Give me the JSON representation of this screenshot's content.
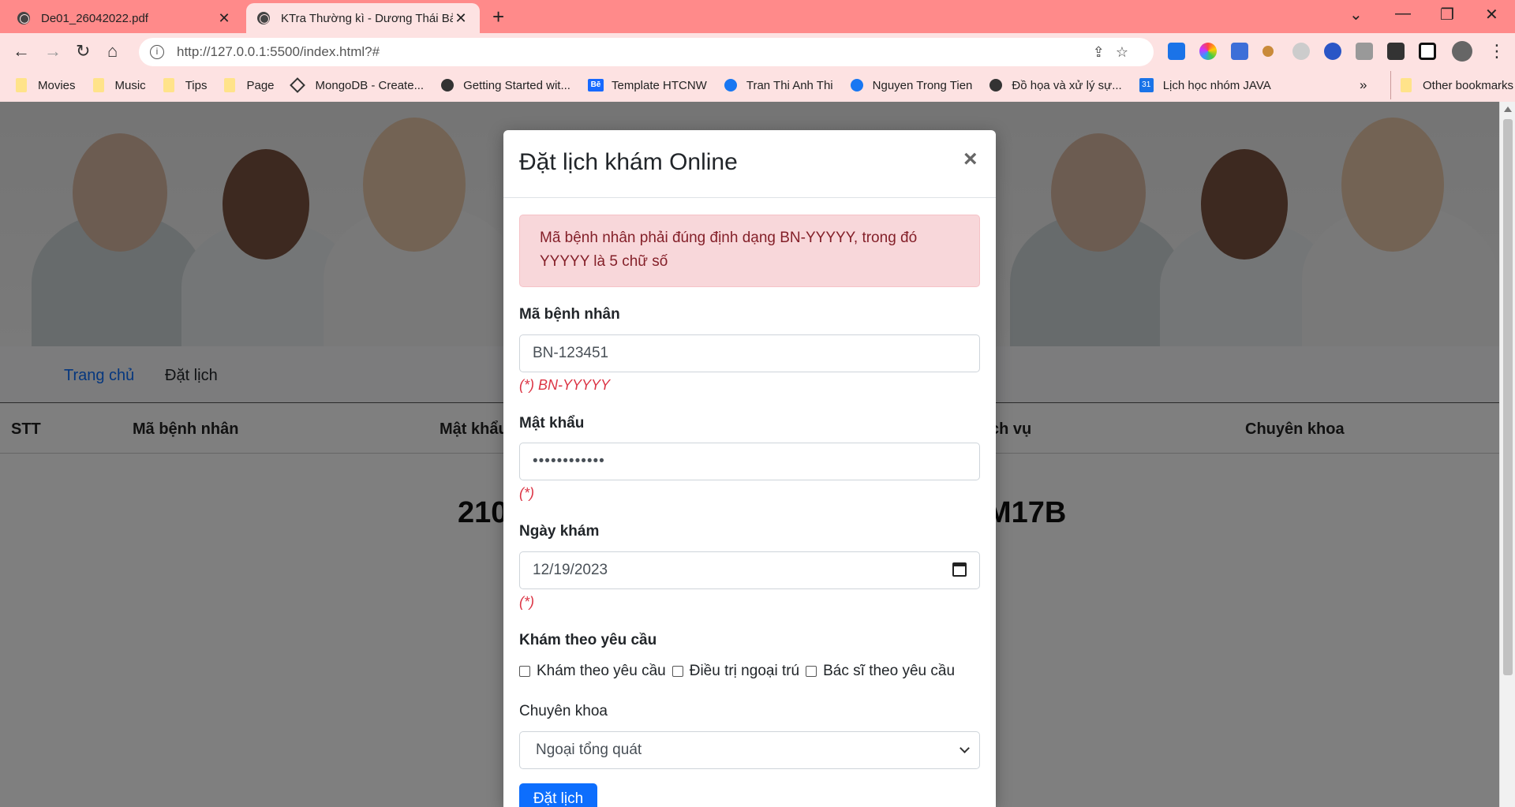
{
  "browser": {
    "tabs": [
      {
        "title": "De01_26042022.pdf",
        "active": false
      },
      {
        "title": "KTra Thường kì - Dương Thái Bảo",
        "active": true
      }
    ],
    "url": "http://127.0.0.1:5500/index.html?#",
    "bookmarks": [
      {
        "label": "Movies",
        "icon": "folder-icon"
      },
      {
        "label": "Music",
        "icon": "folder-icon"
      },
      {
        "label": "Tips",
        "icon": "folder-icon"
      },
      {
        "label": "Page",
        "icon": "folder-icon"
      },
      {
        "label": "MongoDB - Create...",
        "icon": "mongodb-icon"
      },
      {
        "label": "Getting Started wit...",
        "icon": "globe-icon"
      },
      {
        "label": "Template HTCNW",
        "icon": "behance-icon"
      },
      {
        "label": "Tran Thi Anh Thi",
        "icon": "facebook-icon"
      },
      {
        "label": "Nguyen Trong Tien",
        "icon": "facebook-icon"
      },
      {
        "label": "Đồ họa và xử lý sự...",
        "icon": "globe-icon"
      },
      {
        "label": "Lịch học nhóm JAVA",
        "icon": "calendar-icon"
      }
    ],
    "more_bookmarks": "»",
    "other_bookmarks": "Other bookmarks",
    "calendar_icon_text": "31",
    "behance_icon_text": "Bē"
  },
  "page": {
    "nav": {
      "home": "Trang chủ",
      "booking": "Đặt lịch"
    },
    "table_headers": {
      "stt": "STT",
      "patient_id": "Mã bệnh nhân",
      "password": "Mật khẩu",
      "service": "ch vụ",
      "specialty": "Chuyên khoa"
    },
    "row_left": "210",
    "row_right": "M17B"
  },
  "modal": {
    "title": "Đặt lịch khám Online",
    "close": "×",
    "alert": "Mã bệnh nhân phải đúng định dạng BN-YYYYY, trong đó YYYYY là 5 chữ số",
    "patient_id_label": "Mã bệnh nhân",
    "patient_id_value": "BN-123451",
    "patient_id_hint": "(*) BN-YYYYY",
    "password_label": "Mật khẩu",
    "password_value": "••••••••••••",
    "password_hint": "(*)",
    "date_label": "Ngày khám",
    "date_value": "12/19/2023",
    "date_hint": "(*)",
    "request_label": "Khám theo yêu cầu",
    "checkboxes": [
      "Khám theo yêu cầu",
      "Điều trị ngoại trú",
      "Bác sĩ theo yêu cầu"
    ],
    "specialty_label": "Chuyên khoa",
    "specialty_value": "Ngoại tổng quát",
    "submit": "Đặt lịch"
  },
  "colors": {
    "tabstrip": "#ff8a8a",
    "chrome": "#fde2e2",
    "link": "#0d6efd",
    "alert_bg": "#f8d7da",
    "alert_text": "#842029",
    "hint": "#dc3545",
    "primary": "#0d6efd"
  }
}
